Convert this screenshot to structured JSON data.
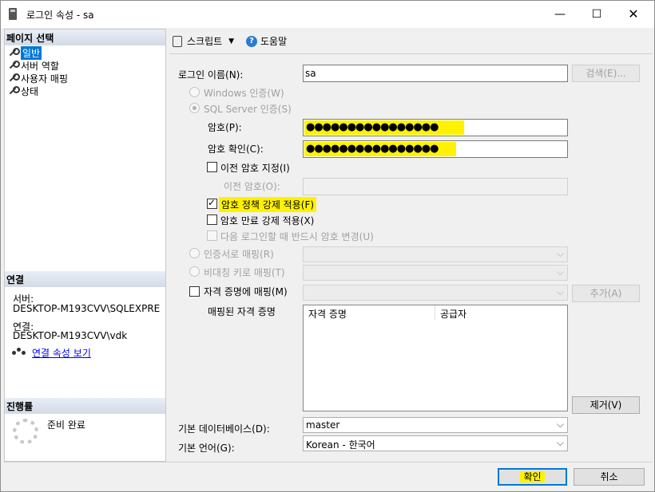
{
  "window": {
    "title": "로그인 속성 - sa",
    "minimize": "—",
    "maximize": "☐",
    "close": "✕"
  },
  "left": {
    "page_select_header": "페이지 선택",
    "pages": [
      "일반",
      "서버 역할",
      "사용자 매핑",
      "상태"
    ],
    "connection_header": "연결",
    "server_label": "서버:",
    "server_value": "DESKTOP-M193CVV\\SQLEXPRE",
    "connection_label": "연결:",
    "connection_value": "DESKTOP-M193CVV\\vdk",
    "view_connection_link": "연결 속성 보기",
    "progress_header": "진행률",
    "progress_status": "준비 완료"
  },
  "toolbar": {
    "script_label": "스크립트",
    "help_label": "도움말"
  },
  "form": {
    "login_name_label": "로그인 이름(N):",
    "login_name_value": "sa",
    "search_button": "검색(E)...",
    "windows_auth": "Windows 인증(W)",
    "sql_auth": "SQL Server 인증(S)",
    "password_label": "암호(P):",
    "password_dots": "●●●●●●●●●●●●●●●●",
    "confirm_label": "암호 확인(C):",
    "confirm_dots": "●●●●●●●●●●●●●●●●",
    "specify_old_password": "이전 암호 지정(I)",
    "old_password_label": "이전 암호(O):",
    "enforce_policy": "암호 정책 강제 적용(F)",
    "enforce_expiration": "암호 만료 강제 적용(X)",
    "must_change": "다음 로그인할 때 반드시 암호 변경(U)",
    "cert_mapped": "인증서로 매핑(R)",
    "asym_key_mapped": "비대칭 키로 매핑(T)",
    "credential_mapped": "자격 증명에 매핑(M)",
    "add_button": "추가(A)",
    "mapped_credentials_label": "매핑된 자격 증명",
    "grid_col_credential": "자격 증명",
    "grid_col_provider": "공급자",
    "remove_button": "제거(V)",
    "default_db_label": "기본 데이터베이스(D):",
    "default_db_value": "master",
    "default_lang_label": "기본 언어(G):",
    "default_lang_value": "Korean - 한국어"
  },
  "footer": {
    "ok_button": "확인",
    "cancel_button": "취소"
  },
  "colors": {
    "highlight": "#fff200",
    "selection": "#0078d7",
    "link": "#0000ee"
  }
}
